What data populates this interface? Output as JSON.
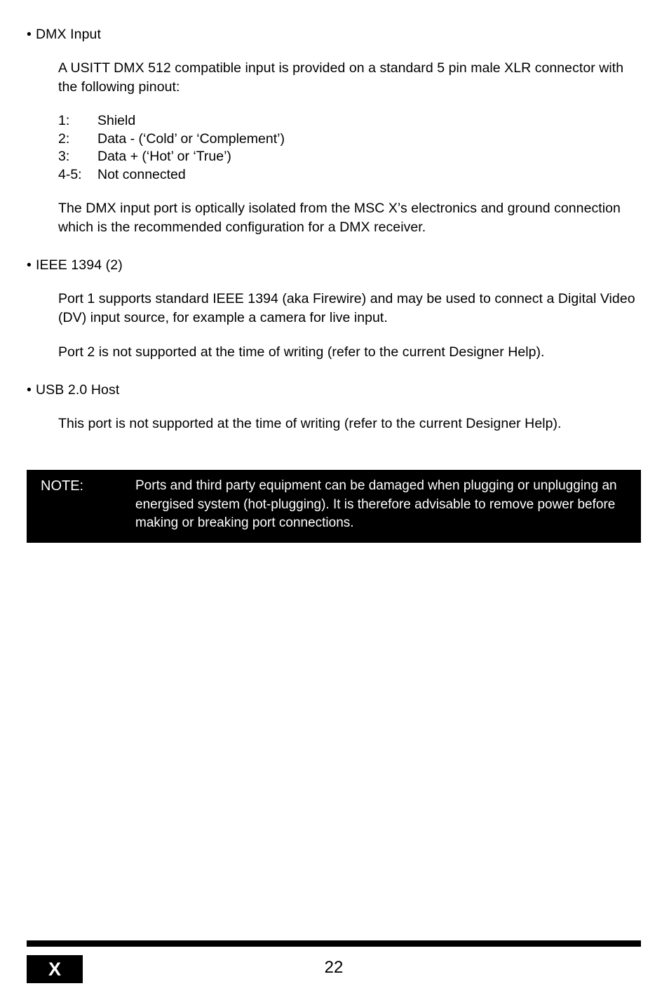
{
  "document": {
    "sections": [
      {
        "bullet": "DMX Input",
        "paragraphs": [
          "A USITT DMX 512 compatible input is provided on a standard 5 pin male XLR connector with the following pinout:"
        ],
        "pinout": [
          {
            "pin": "1:",
            "desc": "Shield"
          },
          {
            "pin": "2:",
            "desc": "Data - (‘Cold’ or ‘Complement’)"
          },
          {
            "pin": "3:",
            "desc": "Data + (‘Hot’ or ‘True’)"
          },
          {
            "pin": "4-5:",
            "desc": "Not connected"
          }
        ],
        "closing": "The DMX input port is optically isolated from the MSC X’s electronics and ground connection which is the recommended configuration for a DMX receiver."
      },
      {
        "bullet": "IEEE 1394 (2)",
        "paragraphs": [
          "Port 1 supports standard IEEE 1394 (aka Firewire) and may be used to connect a Digital Video (DV) input source, for example a camera for live input.",
          "Port 2 is not supported at the time of writing (refer to the current Designer Help)."
        ]
      },
      {
        "bullet": "USB 2.0 Host",
        "paragraphs": [
          "This port is not supported at the time of writing (refer to the current Designer Help)."
        ]
      }
    ],
    "note": {
      "label": "NOTE:",
      "text": "Ports and third party equipment can be damaged when plugging or unplugging an energised system (hot-plugging).  It is therefore advisable to remove power before making or breaking port connections."
    },
    "footer": {
      "logo": "X",
      "page_number": "22"
    },
    "bullet_glyph": "•"
  }
}
